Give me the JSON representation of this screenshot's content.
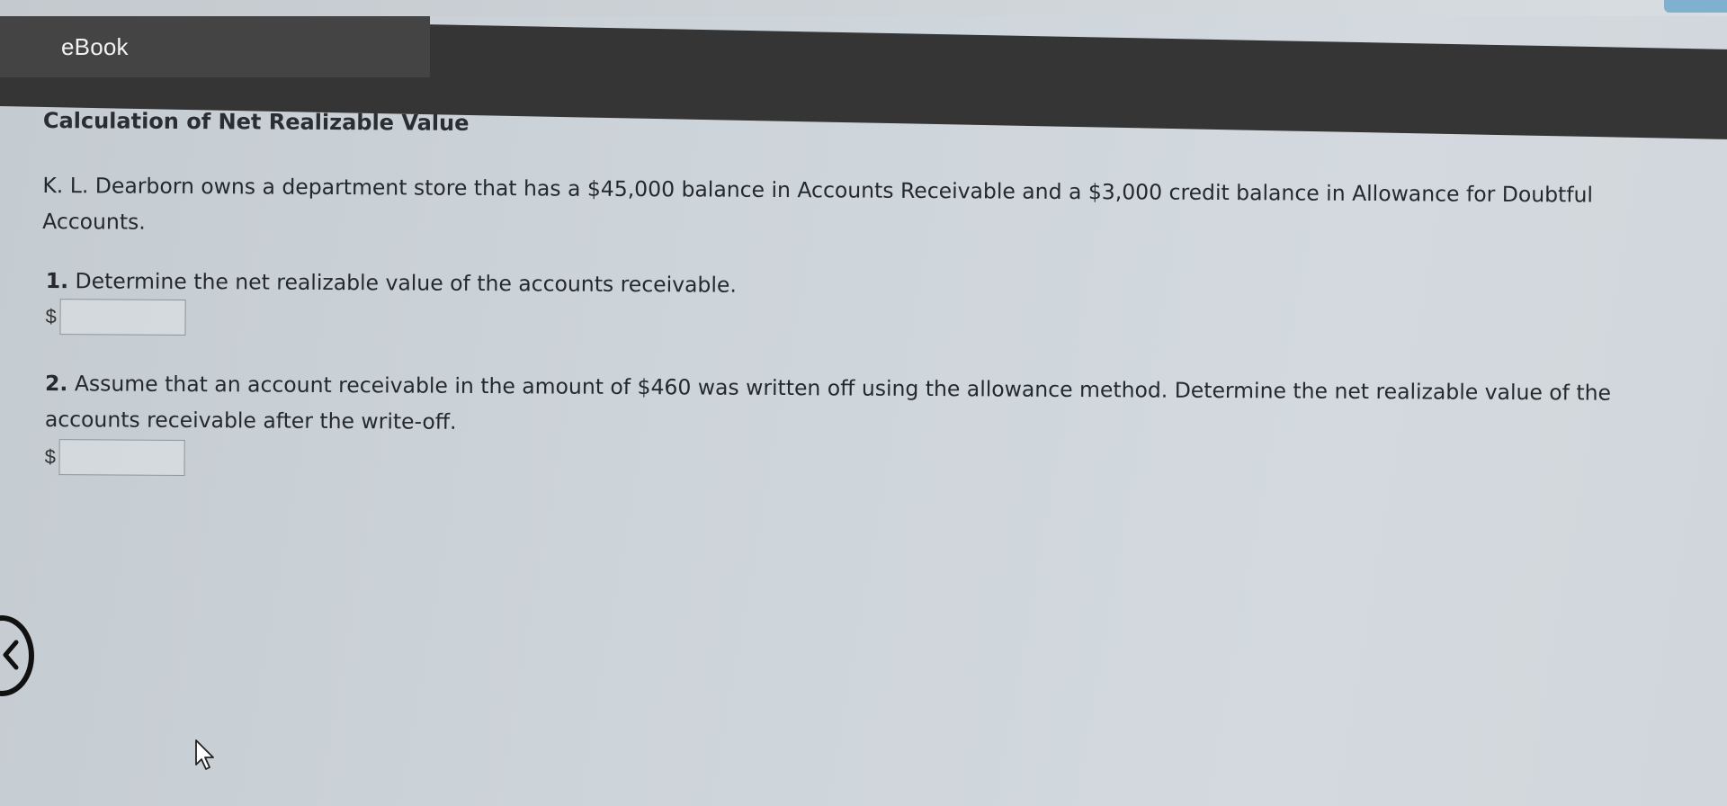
{
  "header": {
    "title": "eBook"
  },
  "main": {
    "section_title": "Calculation of Net Realizable Value",
    "intro": "K. L. Dearborn owns a department store that has a $45,000 balance in Accounts Receivable and a $3,000 credit balance in Allowance for Doubtful Accounts.",
    "questions": [
      {
        "number": "1.",
        "text": "Determine the net realizable value of the accounts receivable.",
        "currency": "$",
        "answer_value": ""
      },
      {
        "number": "2.",
        "text": "Assume that an account receivable in the amount of $460 was written off using the allowance method. Determine the net realizable value of the accounts receivable after the write-off.",
        "currency": "$",
        "answer_value": ""
      }
    ]
  },
  "icons": {
    "side_control": "side-nav-circle-icon",
    "cursor": "mouse-pointer-icon"
  },
  "colors": {
    "header_bg": "#353535",
    "header_tab_bg": "#444444",
    "page_bg": "#cdd4da"
  }
}
